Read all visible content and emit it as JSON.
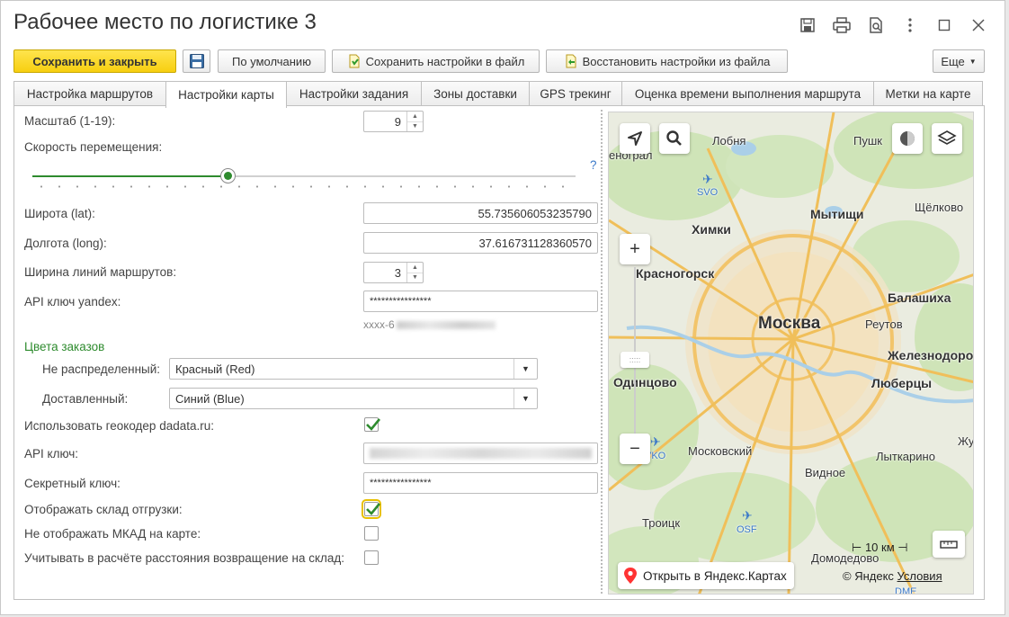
{
  "window": {
    "title": "Рабочее место по логистике 3"
  },
  "toolbar": {
    "save_close": "Сохранить и закрыть",
    "default": "По умолчанию",
    "save_file": "Сохранить настройки в файл",
    "restore_file": "Восстановить настройки из файла",
    "more": "Еще"
  },
  "tabs": [
    {
      "label": "Настройка маршрутов"
    },
    {
      "label": "Настройки карты",
      "active": true
    },
    {
      "label": "Настройки задания"
    },
    {
      "label": "Зоны доставки"
    },
    {
      "label": "GPS трекинг"
    },
    {
      "label": "Оценка времени выполнения маршрута"
    },
    {
      "label": "Метки на карте"
    }
  ],
  "form": {
    "scale_label": "Масштаб (1-19):",
    "scale_value": "9",
    "speed_label": "Скорость перемещения:",
    "speed_help": "?",
    "speed_level": 0.36,
    "lat_label": "Широта (lat):",
    "lat_value": "55.735606053235790",
    "lon_label": "Долгота (long):",
    "lon_value": "37.616731128360570",
    "line_width_label": "Ширина линий маршрутов:",
    "line_width_value": "3",
    "api_yandex_label": "API ключ yandex:",
    "api_yandex_value": "****************",
    "api_yandex_hint": "xxxx-6",
    "order_colors_title": "Цвета заказов",
    "not_distributed_label": "Не распределенный:",
    "not_distributed_value": "Красный (Red)",
    "delivered_label": "Доставленный:",
    "delivered_value": "Синий (Blue)",
    "use_dadata_label": "Использовать геокодер dadata.ru:",
    "use_dadata_checked": true,
    "api_key_label": "API ключ:",
    "secret_label": "Секретный ключ:",
    "secret_value": "****************",
    "show_warehouse_label": "Отображать склад отгрузки:",
    "show_warehouse_checked": true,
    "hide_mkad_label": "Не отображать МКАД на карте:",
    "hide_mkad_checked": false,
    "return_label": "Учитывать в расчёте расстояния возвращение на склад:",
    "return_checked": false
  },
  "map": {
    "cities": {
      "lobnya": "Лобня",
      "pushkino": "Пушк",
      "zelenograd": "енограл",
      "khimki": "Химки",
      "mytishchi": "Мытищи",
      "shchelkovo": "Щёлково",
      "krasnogorsk": "Красногорск",
      "balashikha": "Балашиха",
      "moscow": "Москва",
      "reutov": "Реутов",
      "zheleznodorozhny": "Железнодорож",
      "odintsovo": "Одинцово",
      "lyubertsy": "Люберцы",
      "moskovsky": "Московский",
      "vidnoe": "Видное",
      "lytkarino": "Лыткарино",
      "troitsk": "Троицк",
      "domodedovo": "Домодедово",
      "zhu": "Жу"
    },
    "airports": {
      "svo": "SVO",
      "vko": "VKO",
      "osf": "OSF",
      "dme": "DME"
    },
    "zoom_in": "+",
    "zoom_out": "−",
    "scale_bar": "10 км",
    "open_yandex": "Открыть в Яндекс.Картах",
    "copyright": "© Яндекс",
    "terms": "Условия"
  }
}
